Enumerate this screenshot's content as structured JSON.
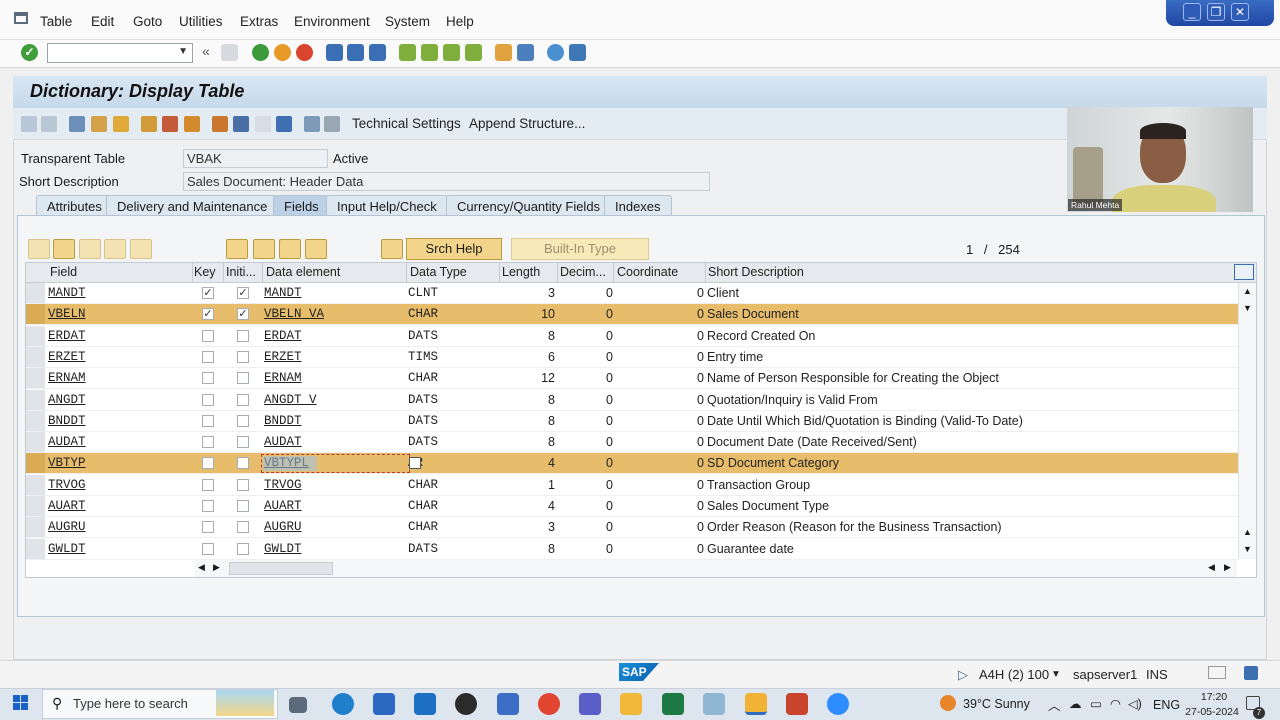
{
  "menu": [
    "Table",
    "Edit",
    "Goto",
    "Utilities",
    "Extras",
    "Environment",
    "System",
    "Help"
  ],
  "window_controls": [
    "_",
    "❐",
    "✕"
  ],
  "page_title": "Dictionary: Display Table",
  "app_toolbar": {
    "technical_settings": "Technical Settings",
    "append_structure": "Append Structure..."
  },
  "header": {
    "transparent_table_label": "Transparent Table",
    "table_name": "VBAK",
    "status": "Active",
    "short_description_label": "Short Description",
    "short_description": "Sales Document: Header Data"
  },
  "tabs": [
    {
      "label": "Attributes",
      "active": false
    },
    {
      "label": "Delivery and Maintenance",
      "active": false
    },
    {
      "label": "Fields",
      "active": true
    },
    {
      "label": "Input Help/Check",
      "active": false
    },
    {
      "label": "Currency/Quantity Fields",
      "active": false
    },
    {
      "label": "Indexes",
      "active": false
    }
  ],
  "table_toolbar": {
    "srch_help": "Srch Help",
    "built_in_type": "Built-In Type",
    "pager_current": "1",
    "pager_sep": "/",
    "pager_total": "254"
  },
  "columns": [
    "Field",
    "Key",
    "Initi...",
    "Data element",
    "Data Type",
    "Length",
    "Decim...",
    "Coordinate",
    "Short Description"
  ],
  "rows": [
    {
      "field": "MANDT",
      "key": true,
      "init": true,
      "data_element": "MANDT",
      "data_type": "CLNT",
      "length": "3",
      "decimals": "0",
      "coordinate": "0",
      "description": "Client",
      "selected": false
    },
    {
      "field": "VBELN",
      "key": true,
      "init": true,
      "data_element": "VBELN_VA",
      "data_type": "CHAR",
      "length": "10",
      "decimals": "0",
      "coordinate": "0",
      "description": "Sales Document",
      "selected": true
    },
    {
      "field": "ERDAT",
      "key": false,
      "init": false,
      "data_element": "ERDAT",
      "data_type": "DATS",
      "length": "8",
      "decimals": "0",
      "coordinate": "0",
      "description": "Record Created On",
      "selected": false
    },
    {
      "field": "ERZET",
      "key": false,
      "init": false,
      "data_element": "ERZET",
      "data_type": "TIMS",
      "length": "6",
      "decimals": "0",
      "coordinate": "0",
      "description": "Entry time",
      "selected": false
    },
    {
      "field": "ERNAM",
      "key": false,
      "init": false,
      "data_element": "ERNAM",
      "data_type": "CHAR",
      "length": "12",
      "decimals": "0",
      "coordinate": "0",
      "description": "Name of Person Responsible for Creating the Object",
      "selected": false
    },
    {
      "field": "ANGDT",
      "key": false,
      "init": false,
      "data_element": "ANGDT_V",
      "data_type": "DATS",
      "length": "8",
      "decimals": "0",
      "coordinate": "0",
      "description": "Quotation/Inquiry is Valid From",
      "selected": false
    },
    {
      "field": "BNDDT",
      "key": false,
      "init": false,
      "data_element": "BNDDT",
      "data_type": "DATS",
      "length": "8",
      "decimals": "0",
      "coordinate": "0",
      "description": "Date Until Which Bid/Quotation is Binding (Valid-To Date)",
      "selected": false
    },
    {
      "field": "AUDAT",
      "key": false,
      "init": false,
      "data_element": "AUDAT",
      "data_type": "DATS",
      "length": "8",
      "decimals": "0",
      "coordinate": "0",
      "description": "Document Date (Date Received/Sent)",
      "selected": false
    },
    {
      "field": "VBTYP",
      "key": false,
      "init": false,
      "data_element": "VBTYPL",
      "data_type": "AR",
      "length": "4",
      "decimals": "0",
      "coordinate": "0",
      "description": "SD Document Category",
      "selected": true
    },
    {
      "field": "TRVOG",
      "key": false,
      "init": false,
      "data_element": "TRVOG",
      "data_type": "CHAR",
      "length": "1",
      "decimals": "0",
      "coordinate": "0",
      "description": "Transaction Group",
      "selected": false
    },
    {
      "field": "AUART",
      "key": false,
      "init": false,
      "data_element": "AUART",
      "data_type": "CHAR",
      "length": "4",
      "decimals": "0",
      "coordinate": "0",
      "description": "Sales Document Type",
      "selected": false
    },
    {
      "field": "AUGRU",
      "key": false,
      "init": false,
      "data_element": "AUGRU",
      "data_type": "CHAR",
      "length": "3",
      "decimals": "0",
      "coordinate": "0",
      "description": "Order Reason (Reason for the Business Transaction)",
      "selected": false
    },
    {
      "field": "GWLDT",
      "key": false,
      "init": false,
      "data_element": "GWLDT",
      "data_type": "DATS",
      "length": "8",
      "decimals": "0",
      "coordinate": "0",
      "description": "Guarantee date",
      "selected": false
    }
  ],
  "webcam": {
    "name": "Rahul Mehta"
  },
  "status_bar": {
    "logo": "SAP",
    "system": "A4H (2) 100",
    "server": "sapserver1",
    "mode": "INS"
  },
  "taskbar": {
    "search_placeholder": "Type here to search",
    "weather": "39°C  Sunny",
    "language": "ENG",
    "time": "17:20",
    "date": "27-05-2024",
    "notification_count": "7"
  },
  "colors": {
    "selection": "#e7bd6b",
    "title_bar": "#c6d9ea",
    "button_yellow": "#f2d58a"
  }
}
